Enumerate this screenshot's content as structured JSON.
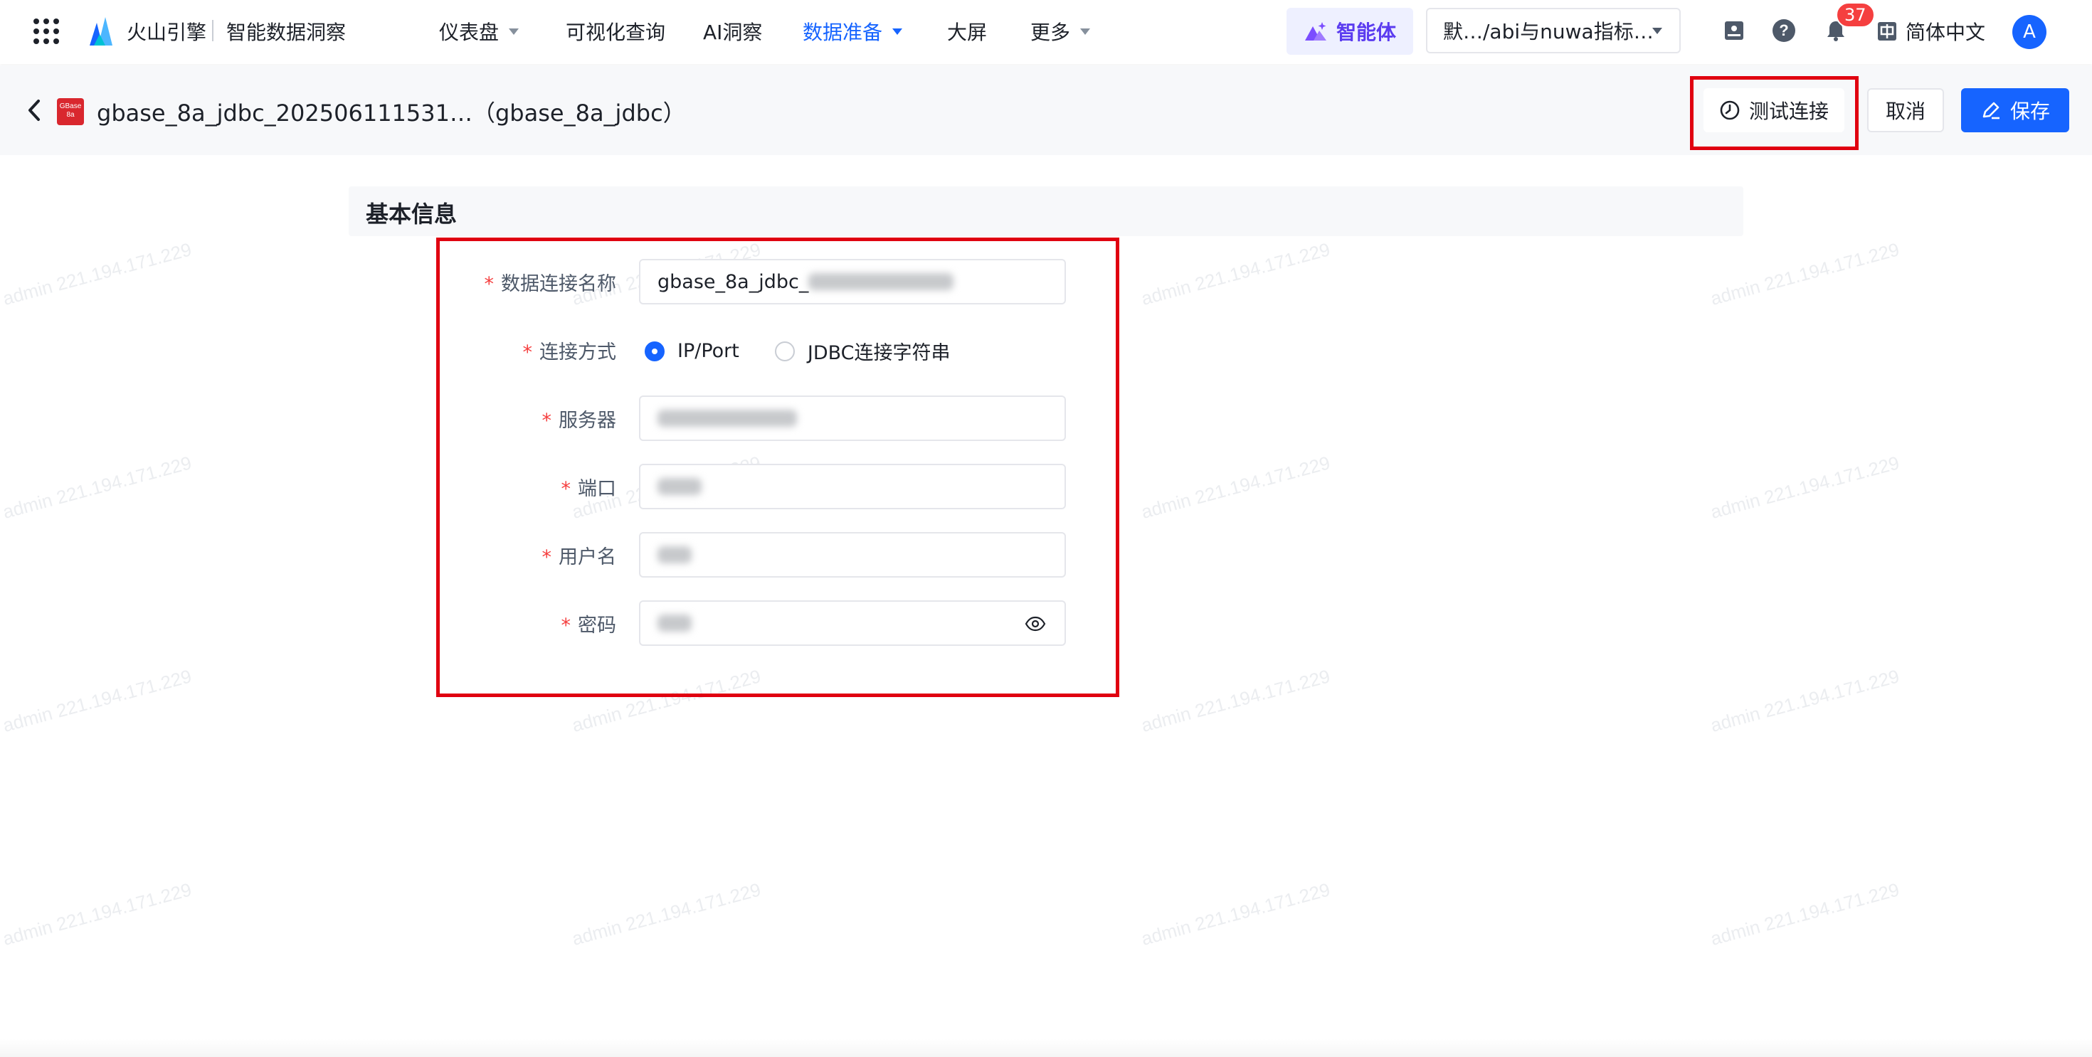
{
  "watermark": "admin 221.194.171.229",
  "topnav": {
    "brand": "火山引擎",
    "product": "智能数据洞察",
    "items": [
      {
        "label": "仪表盘",
        "has_caret": true,
        "active": false
      },
      {
        "label": "可视化查询",
        "has_caret": false,
        "active": false
      },
      {
        "label": "AI洞察",
        "has_caret": false,
        "active": false
      },
      {
        "label": "数据准备",
        "has_caret": true,
        "active": true
      },
      {
        "label": "大屏",
        "has_caret": false,
        "active": false
      },
      {
        "label": "更多",
        "has_caret": true,
        "active": false
      }
    ],
    "agent_label": "智能体",
    "workspace": "默…/abi与nuwa指标…",
    "notification_count": "37",
    "language": "简体中文",
    "avatar_initial": "A"
  },
  "subheader": {
    "datasource_logo_text": "GBase 8a",
    "title": "gbase_8a_jdbc_202506111531…（gbase_8a_jdbc）",
    "test_button": "测试连接",
    "cancel_button": "取消",
    "save_button": "保存"
  },
  "form": {
    "section_title": "基本信息",
    "fields": {
      "name": {
        "label": "数据连接名称",
        "value": "gbase_8a_jdbc_"
      },
      "method": {
        "label": "连接方式",
        "options": [
          "IP/Port",
          "JDBC连接字符串"
        ],
        "selected": "IP/Port"
      },
      "server": {
        "label": "服务器"
      },
      "port": {
        "label": "端口"
      },
      "username": {
        "label": "用户名"
      },
      "password": {
        "label": "密码"
      }
    }
  },
  "colors": {
    "accent": "#1664ff",
    "highlight": "#e00010",
    "required": "#f53f3f",
    "ds_logo": "#d9272e"
  }
}
